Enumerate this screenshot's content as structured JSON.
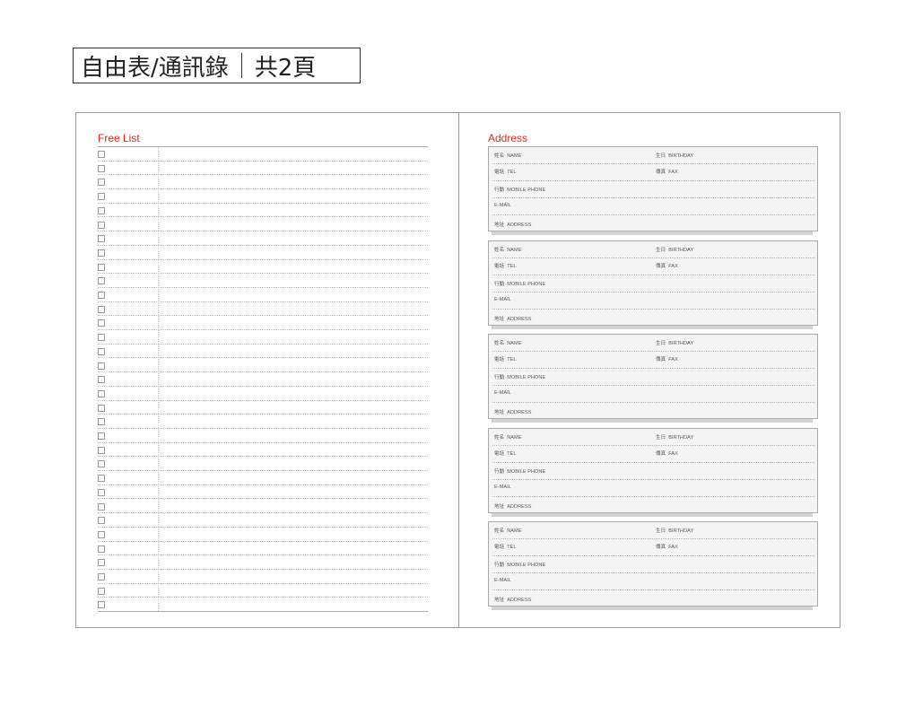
{
  "header": {
    "title": "自由表/通訊錄",
    "pages": "共2頁"
  },
  "free_list": {
    "title": "Free List",
    "row_count": 33
  },
  "address": {
    "title": "Address",
    "card_count": 5,
    "fields": {
      "name_zh": "姓名",
      "name_en": "NAME",
      "birthday_zh": "生日",
      "birthday_en": "BIRTHDAY",
      "tel_zh": "電話",
      "tel_en": "TEL",
      "fax_zh": "傳真",
      "fax_en": "FAX",
      "mobile_zh": "行動",
      "mobile_en": "MOBILE PHONE",
      "email_en": "E-MAIL",
      "address_zh": "地址",
      "address_en": "ADDRESS"
    }
  }
}
